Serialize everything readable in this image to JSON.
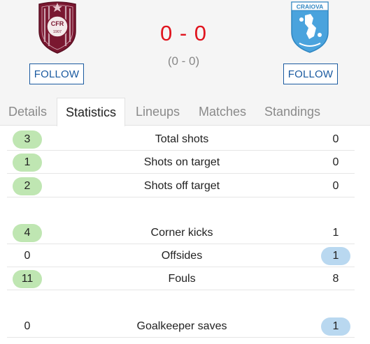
{
  "match": {
    "score": "0 - 0",
    "halftime_score": "(0 - 0)",
    "home": {
      "crest_icon": "cfr-cluj-crest-icon",
      "crest_text": "CFR",
      "crest_year": "1907",
      "follow_label": "FOLLOW"
    },
    "away": {
      "crest_icon": "universitatea-craiova-crest-icon",
      "crest_text": "CRAIOVA",
      "follow_label": "FOLLOW"
    }
  },
  "tabs": [
    {
      "label": "Details",
      "active": false
    },
    {
      "label": "Statistics",
      "active": true
    },
    {
      "label": "Lineups",
      "active": false
    },
    {
      "label": "Matches",
      "active": false
    },
    {
      "label": "Standings",
      "active": false
    }
  ],
  "stats": [
    {
      "label": "Total shots",
      "home": "3",
      "away": "0",
      "leader": "home"
    },
    {
      "label": "Shots on target",
      "home": "1",
      "away": "0",
      "leader": "home"
    },
    {
      "label": "Shots off target",
      "home": "2",
      "away": "0",
      "leader": "home"
    },
    {
      "label": "Corner kicks",
      "home": "4",
      "away": "1",
      "leader": "home"
    },
    {
      "label": "Offsides",
      "home": "0",
      "away": "1",
      "leader": "away"
    },
    {
      "label": "Fouls",
      "home": "11",
      "away": "8",
      "leader": "home"
    },
    {
      "label": "Goalkeeper saves",
      "home": "0",
      "away": "1",
      "leader": "away"
    }
  ],
  "colors": {
    "score": "#e0141e",
    "follow": "#1a5aa0",
    "home_highlight": "#bfe6b2",
    "away_highlight": "#b9d8f0"
  }
}
